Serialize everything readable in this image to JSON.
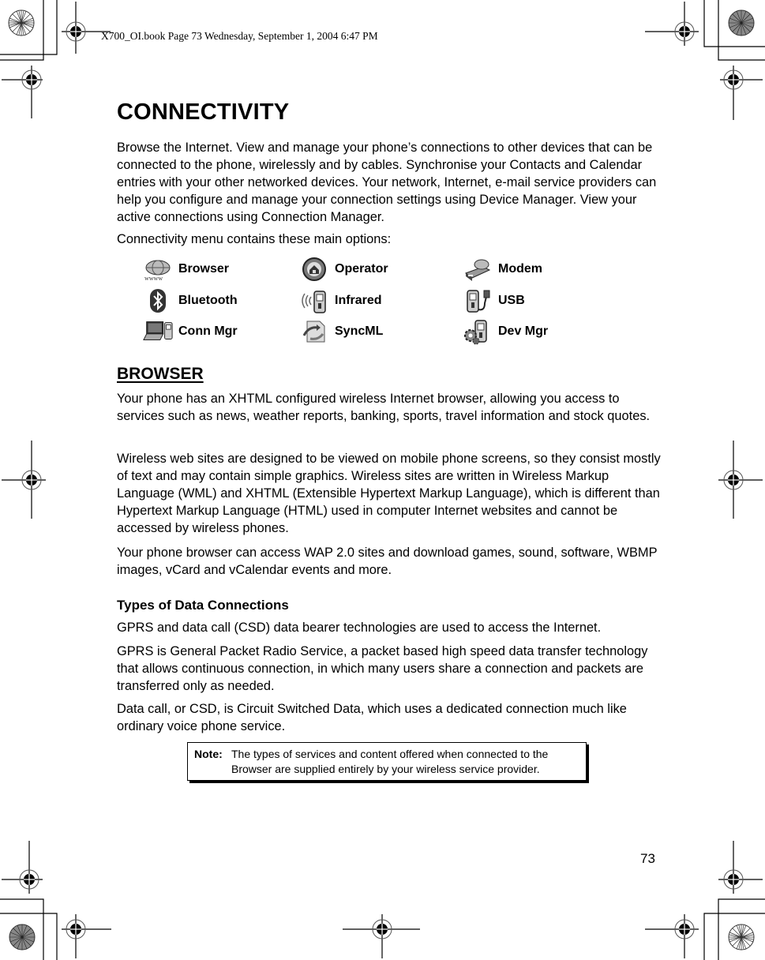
{
  "header": {
    "slug": "X700_OI.book  Page 73  Wednesday, September 1, 2004  6:47 PM"
  },
  "title": "CONNECTIVITY",
  "intro": "Browse the Internet. View and manage your phone’s connections to other devices that can be connected to the phone, wirelessly and by cables. Synchronise your Contacts and Calendar entries with your other networked devices. Your network, Internet, e-mail service providers can help you configure and manage your connection settings using Device Manager. View your active connections using Connection Manager.",
  "menu_intro": "Connectivity menu contains these main options:",
  "menu": [
    {
      "label": "Browser",
      "icon": "browser-globe-icon"
    },
    {
      "label": "Operator",
      "icon": "operator-home-icon"
    },
    {
      "label": "Modem",
      "icon": "modem-icon"
    },
    {
      "label": "Bluetooth",
      "icon": "bluetooth-icon"
    },
    {
      "label": "Infrared",
      "icon": "infrared-phone-icon"
    },
    {
      "label": "USB",
      "icon": "usb-phone-icon"
    },
    {
      "label": "Conn Mgr",
      "icon": "laptop-phone-icon"
    },
    {
      "label": "SyncML",
      "icon": "sync-icon"
    },
    {
      "label": "Dev Mgr",
      "icon": "gears-phone-icon"
    }
  ],
  "browser_section": {
    "heading": "BROWSER",
    "paragraphs": [
      "Your phone has an XHTML configured wireless Internet browser, allowing you access to services such as news, weather reports, banking, sports, travel information and stock quotes.",
      "Wireless web sites are designed to be viewed on mobile phone screens, so they consist mostly of text and may contain simple graphics. Wireless sites are written in Wireless Markup Language (WML) and XHTML (Extensible Hypertext Markup Language), which is different than Hypertext Markup Language (HTML) used in computer Internet websites and cannot be accessed by wireless phones.",
      "Your phone browser can access WAP 2.0 sites and download games, sound, software, WBMP images, vCard and vCalendar events and more."
    ]
  },
  "data_connections": {
    "heading": "Types of Data Connections",
    "paragraphs": [
      "GPRS and data call (CSD) data bearer technologies are used to access the Internet.",
      "GPRS is General Packet Radio Service, a packet based high speed data transfer technology that allows continuous connection, in which many users share a connection and packets are transferred only as needed.",
      "Data call, or CSD, is Circuit Switched Data, which uses a dedicated connection much like ordinary voice phone service."
    ]
  },
  "note": {
    "label": "Note:",
    "text": "The types of services and content offered when connected to the Browser are supplied entirely by your wireless service provider."
  },
  "page_number": "73"
}
